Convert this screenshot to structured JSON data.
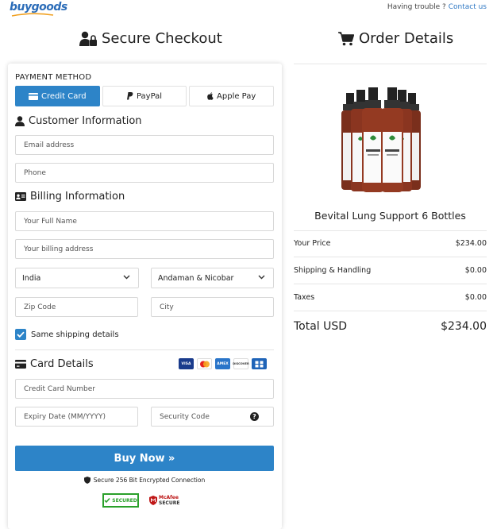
{
  "brand": {
    "logo_text": "buygoods"
  },
  "header": {
    "trouble_text": "Having trouble ?",
    "contact_link": "Contact us"
  },
  "checkout": {
    "title": "Secure Checkout",
    "payment_method_label": "PAYMENT METHOD",
    "payment_tabs": [
      {
        "label": "Credit Card",
        "icon": "credit-card-icon",
        "active": true
      },
      {
        "label": "PayPal",
        "icon": "paypal-icon",
        "active": false
      },
      {
        "label": "Apple Pay",
        "icon": "apple-icon",
        "active": false
      }
    ],
    "customer_section": {
      "title": "Customer Information",
      "email_placeholder": "Email address",
      "phone_placeholder": "Phone"
    },
    "billing_section": {
      "title": "Billing Information",
      "name_placeholder": "Your Full Name",
      "address_placeholder": "Your billing address",
      "country_value": "India",
      "state_value": "Andaman & Nicobar",
      "zip_placeholder": "Zip Code",
      "city_placeholder": "City",
      "same_shipping_label": "Same shipping details",
      "same_shipping_checked": true
    },
    "card_section": {
      "title": "Card Details",
      "card_logos": [
        "VISA",
        "mastercard",
        "AMEX",
        "DISCOVER",
        "JCB"
      ],
      "card_number_placeholder": "Credit Card Number",
      "expiry_placeholder": "Expiry Date (MM/YYYY)",
      "security_placeholder": "Security Code",
      "help_icon_text": "?"
    },
    "buy_button": "Buy Now »",
    "secure_note": "Secure 256 Bit Encrypted Connection",
    "badges": {
      "secured": "SECURED",
      "mcafee_line1": "McAfee",
      "mcafee_line2": "SECURE"
    }
  },
  "order": {
    "title": "Order Details",
    "product_name": "Bevital Lung Support 6 Bottles",
    "rows": [
      {
        "label": "Your Price",
        "value": "$234.00"
      },
      {
        "label": "Shipping & Handling",
        "value": "$0.00"
      },
      {
        "label": "Taxes",
        "value": "$0.00"
      }
    ],
    "total_label": "Total USD",
    "total_value": "$234.00"
  },
  "colors": {
    "accent": "#2d84c8",
    "link": "#2f78c4",
    "text": "#222222",
    "secured_green": "#2aa02a"
  }
}
